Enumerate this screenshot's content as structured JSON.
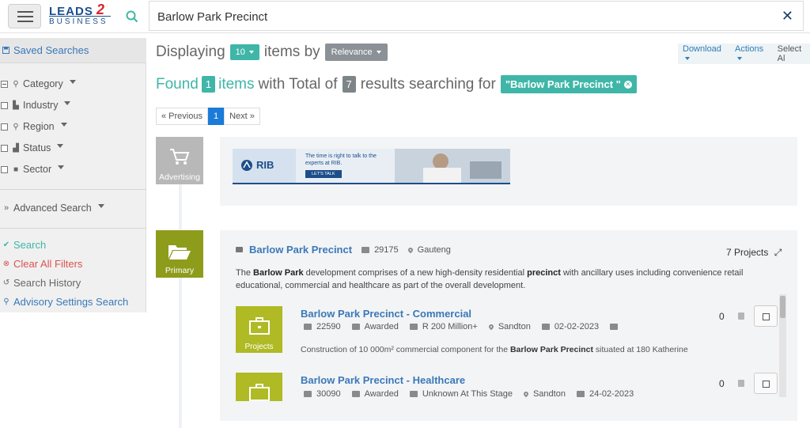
{
  "header": {
    "logo_main": "LEADS",
    "logo_num": "2",
    "logo_sub": "BUSINESS",
    "search_value": "Barlow Park Precinct",
    "close_glyph": "✕"
  },
  "sidebar": {
    "saved_searches": "Saved Searches",
    "filters": [
      {
        "label": "Category",
        "icon": "tags-icon"
      },
      {
        "label": "Industry",
        "icon": "chart-icon"
      },
      {
        "label": "Region",
        "icon": "pin-icon"
      },
      {
        "label": "Status",
        "icon": "status-icon"
      },
      {
        "label": "Sector",
        "icon": "truck-icon"
      }
    ],
    "advanced_search": "Advanced Search",
    "actions": {
      "search": "Search",
      "clear": "Clear All Filters",
      "history": "Search History",
      "advisory": "Advisory Settings Search"
    }
  },
  "results_bar": {
    "displaying": "Displaying",
    "per_page": "10",
    "items_by": "items by",
    "sort": "Relevance",
    "download": "Download",
    "actions": "Actions",
    "select_all": "Select Al"
  },
  "found": {
    "found": "Found",
    "count": "1",
    "items_with_total": "items",
    "with_total_of": "with Total of",
    "total": "7",
    "results_text": "results searching for",
    "query_tag": "\"Barlow Park Precinct \""
  },
  "pagination": {
    "prev": "« Previous",
    "current": "1",
    "next": "Next »"
  },
  "tiles": {
    "advertising": "Advertising",
    "primary": "Primary",
    "projects": "Projects"
  },
  "ad": {
    "brand": "RIB",
    "headline": "The time is right to talk to the experts at RIB.",
    "cta": "LET'S TALK"
  },
  "primary": {
    "name": "Barlow Park Precinct",
    "id": "29175",
    "region": "Gauteng",
    "projects_count": "7 Projects",
    "desc_1": "The ",
    "desc_b1": "Barlow Park",
    "desc_2": " development comprises of a new high-density residential ",
    "desc_b2": "precinct",
    "desc_3": " with ancillary uses including convenience retail educational, commercial and healthcare as part of the overall development."
  },
  "projects": [
    {
      "title_a": "Barlow Park Precinct - ",
      "title_b": "Commercial",
      "id": "22590",
      "status": "Awarded",
      "value": "R 200 Million+",
      "location": "Sandton",
      "date": "02-02-2023",
      "count": "0",
      "desc_a": "Construction of 10 000m² commercial component for the ",
      "desc_b": "Barlow Park Precinct",
      "desc_c": " situated at 180 Katherine"
    },
    {
      "title_a": "Barlow Park Precinct - ",
      "title_b": "Healthcare",
      "id": "30090",
      "status": "Awarded",
      "value": "Unknown At This Stage",
      "location": "Sandton",
      "date": "24-02-2023",
      "count": "0"
    }
  ],
  "colors": {
    "teal": "#3fb6a8",
    "link_blue": "#3a78b8",
    "olive": "#8e9c1c",
    "olive_light": "#afba24",
    "danger": "#d9534f"
  }
}
